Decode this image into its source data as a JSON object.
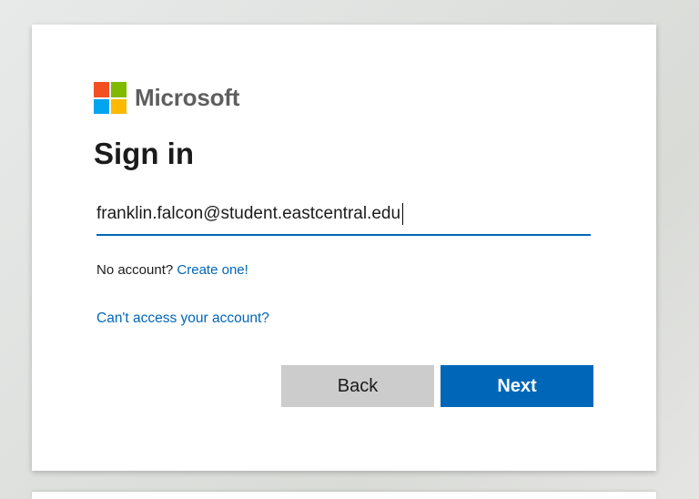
{
  "brand": {
    "name": "Microsoft",
    "colors": {
      "red": "#f25022",
      "green": "#7fba00",
      "blue": "#00a4ef",
      "yellow": "#ffb900",
      "accent": "#0067b8"
    }
  },
  "form": {
    "title": "Sign in",
    "email_value": "franklin.falcon@student.eastcentral.edu",
    "no_account_text": "No account?",
    "create_link": "Create one!",
    "cant_access_link": "Can't access your account?"
  },
  "buttons": {
    "back_label": "Back",
    "next_label": "Next"
  }
}
